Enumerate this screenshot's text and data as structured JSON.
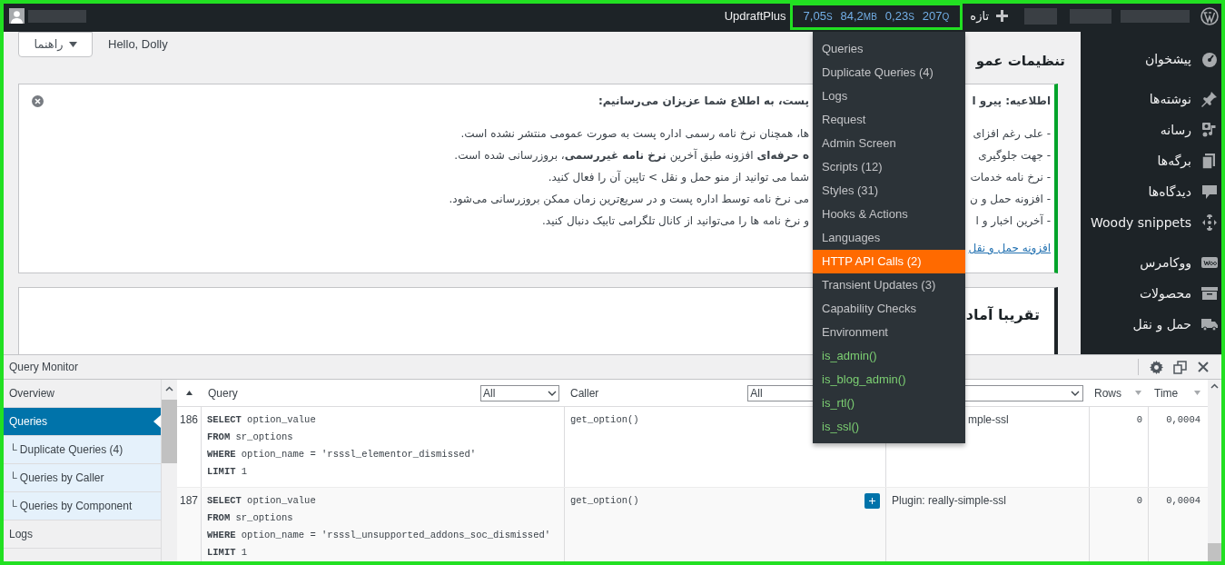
{
  "admin_bar": {
    "plugin_link": "UpdraftPlus",
    "stats": [
      {
        "value": "207",
        "unit": "Q"
      },
      {
        "value": "0,23",
        "unit": "S"
      },
      {
        "value": "84,2",
        "unit": "MB"
      },
      {
        "value": "7,05",
        "unit": "S"
      }
    ],
    "new_label": "تازه"
  },
  "help_button": "راهنما",
  "greeting": "Hello, Dolly",
  "page_title": "تنظیمات عمو",
  "notice": {
    "title": {
      "right": "اطلاعیه: پیرو ا",
      "left": "پست، به اطلاع شما عزیزان می‌رسانیم:"
    },
    "lines": [
      {
        "right": "- علی رغم افزای",
        "left": "ها، همچنان نرخ نامه رسمی اداره پست به صورت عمومی منتشر نشده است."
      },
      {
        "right": "- جهت جلوگیری",
        "left": "**ه حرفه‌ای** افزونه طبق آخرین **نرخ نامه غیررسمی**، بروزرسانی شده است."
      },
      {
        "right": "- نرخ نامه خدمات",
        "left": "شما می توانید از منو حمل و نقل > تاپین آن را فعال کنید."
      },
      {
        "right": "- افزونه حمل و ن",
        "left": "می نرخ نامه توسط اداره پست و در سریع‌ترین زمان ممکن بروزرسانی می‌شود."
      },
      {
        "right": "- آخرین اخبار و ا",
        "left": "و نرخ نامه ها را می‌توانید از کانال تلگرامی تابیک دنبال کنید."
      }
    ],
    "link": "افزونه حمل و نقل"
  },
  "section_title": "تقریبا آماد",
  "sidebar": {
    "items": [
      {
        "label": "پیشخوان"
      },
      {
        "label": "نوشته‌ها"
      },
      {
        "label": "رسانه"
      },
      {
        "label": "برگه‌ها"
      },
      {
        "label": "دیدگاه‌ها"
      },
      {
        "label": "Woody snippets"
      },
      {
        "label": "ووکامرس"
      },
      {
        "label": "محصولات"
      },
      {
        "label": "حمل و نقل"
      }
    ]
  },
  "dropdown": {
    "items": [
      {
        "label": "Queries",
        "kind": "panel",
        "highlighted": false
      },
      {
        "label": "Duplicate Queries (4)",
        "kind": "panel",
        "highlighted": false
      },
      {
        "label": "Logs",
        "kind": "panel",
        "highlighted": false
      },
      {
        "label": "Request",
        "kind": "panel",
        "highlighted": false
      },
      {
        "label": "Admin Screen",
        "kind": "panel",
        "highlighted": false
      },
      {
        "label": "Scripts (12)",
        "kind": "panel",
        "highlighted": false
      },
      {
        "label": "Styles (31)",
        "kind": "panel",
        "highlighted": false
      },
      {
        "label": "Hooks & Actions",
        "kind": "panel",
        "highlighted": false
      },
      {
        "label": "Languages",
        "kind": "panel",
        "highlighted": false
      },
      {
        "label": "HTTP API Calls (2)",
        "kind": "panel",
        "highlighted": true
      },
      {
        "label": "Transient Updates (3)",
        "kind": "panel",
        "highlighted": false
      },
      {
        "label": "Capability Checks",
        "kind": "panel",
        "highlighted": false
      },
      {
        "label": "Environment",
        "kind": "panel",
        "highlighted": false
      },
      {
        "label": "is_admin()",
        "kind": "condition",
        "highlighted": false
      },
      {
        "label": "is_blog_admin()",
        "kind": "condition",
        "highlighted": false
      },
      {
        "label": "is_rtl()",
        "kind": "condition",
        "highlighted": false
      },
      {
        "label": "is_ssl()",
        "kind": "condition",
        "highlighted": false
      }
    ]
  },
  "query_monitor": {
    "title": "Query Monitor",
    "nav": [
      {
        "label": "Overview",
        "selected": false
      },
      {
        "label": "Queries",
        "selected": true,
        "children": [
          {
            "label": "└ Duplicate Queries (4)",
            "selected": false
          },
          {
            "label": "└ Queries by Caller",
            "selected": false
          },
          {
            "label": "└ Queries by Component",
            "selected": false
          }
        ]
      },
      {
        "label": "Logs",
        "selected": false
      }
    ],
    "columns": {
      "query": "Query",
      "query_filter": "All",
      "caller": "Caller",
      "caller_filter": "All",
      "rows": "Rows",
      "time": "Time"
    },
    "rows": [
      {
        "number": "186",
        "query": [
          "**SELECT** option_value",
          "**FROM** sr_options",
          "**WHERE** option_name = 'rsssl_elementor_dismissed'",
          "**LIMIT** 1"
        ],
        "caller": "get_option()",
        "component": "mple-ssl",
        "rows": "0",
        "time": "0,0004"
      },
      {
        "number": "187",
        "query": [
          "**SELECT** option_value",
          "**FROM** sr_options",
          "**WHERE** option_name = 'rsssl_unsupported_addons_soc_dismissed'",
          "**LIMIT** 1"
        ],
        "caller": "get_option()",
        "plus_button": true,
        "component": "Plugin: really-simple-ssl",
        "rows": "0",
        "time": "0,0004"
      }
    ]
  }
}
